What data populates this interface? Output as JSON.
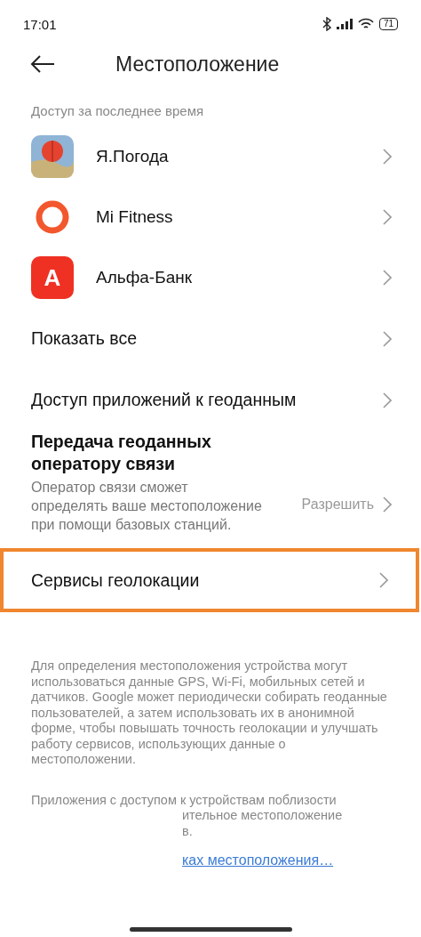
{
  "status_bar": {
    "time": "17:01",
    "battery": "71"
  },
  "header": {
    "title": "Местоположение"
  },
  "recent": {
    "label": "Доступ за последнее время",
    "apps": [
      {
        "name": "Я.Погода",
        "kind": "weather"
      },
      {
        "name": "Mi Fitness",
        "kind": "ring"
      },
      {
        "name": "Альфа-Банк",
        "kind": "letter",
        "logo_text": "А"
      }
    ]
  },
  "items": [
    {
      "title": "Показать все",
      "highlighted": false
    },
    {
      "title": "Доступ приложений к геоданным",
      "highlighted": false
    },
    {
      "title": "Передача геоданных оператору связи",
      "description": "Оператор связи сможет определять ваше местоположение при помощи базовых станций.",
      "value": "Разрешить",
      "highlighted": false
    },
    {
      "title": "Сервисы геолокации",
      "highlighted": true
    }
  ],
  "footer": {
    "note": "Для определения местоположения устройства могут использоваться данные GPS, Wi-Fi, мобильных сетей и датчиков. Google может периодически собирать геоданные пользователей, а затем использовать их в анонимной форме, чтобы повышать точность геолокации и улучшать работу сервисов, использующих данные о местоположении.",
    "partial_lines": [
      "Приложения с доступом к устройствам поблизости",
      "ительное местоположение",
      "в."
    ],
    "link": "ках местоположения…"
  }
}
